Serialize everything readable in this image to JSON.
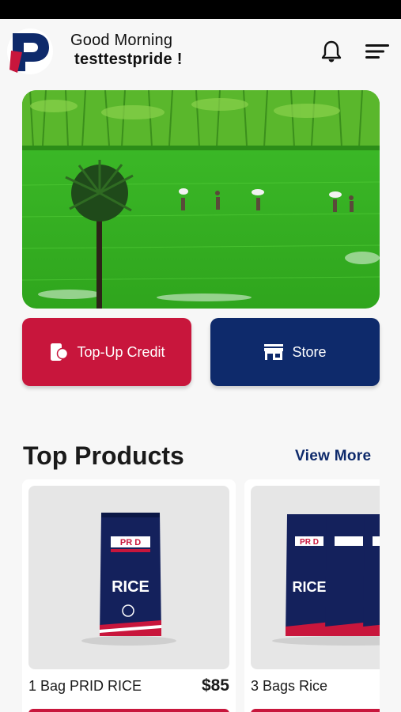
{
  "header": {
    "greeting": "Good Morning",
    "username": "testtestpride !",
    "logo_icon": "pride-p-logo",
    "notification_icon": "bell-icon",
    "menu_icon": "menu-icon"
  },
  "banner": {
    "image": "rice-paddy-field-photo"
  },
  "actions": {
    "topup_label": "Top-Up Credit",
    "topup_icon": "wallet-phone-icon",
    "store_label": "Store",
    "store_icon": "storefront-icon"
  },
  "top_products": {
    "title": "Top Products",
    "view_more": "View More",
    "items": [
      {
        "name": "1 Bag PRID RICE",
        "price": "$85",
        "bag_brand": "PR D",
        "bag_text": "RICE"
      },
      {
        "name": "3 Bags Rice",
        "price": "",
        "bag_brand": "PR D",
        "bag_text": "RICE"
      }
    ]
  },
  "colors": {
    "brand_red": "#c8163c",
    "brand_navy": "#0e2a6b"
  }
}
